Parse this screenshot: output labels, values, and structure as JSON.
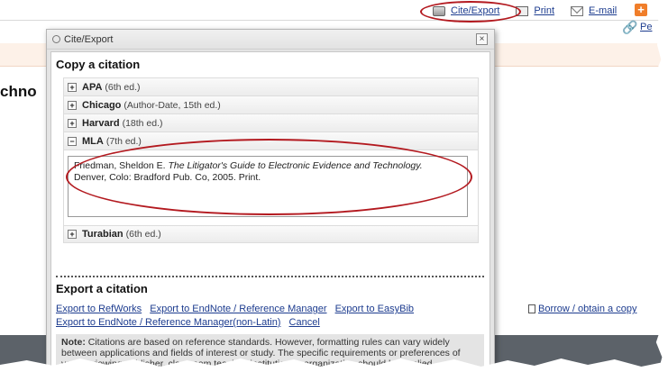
{
  "top_links": {
    "cite_export": "Cite/Export",
    "print": "Print",
    "email": "E-mail",
    "permalink": "Pe"
  },
  "background": {
    "title_fragment": "chno",
    "borrow": "Borrow / obtain a copy"
  },
  "dialog": {
    "title": "Cite/Export",
    "close": "×",
    "copy_heading": "Copy a citation",
    "styles": [
      {
        "name": "APA",
        "edition": "(6th ed.)",
        "toggle": "+"
      },
      {
        "name": "Chicago",
        "edition": "(Author-Date, 15th ed.)",
        "toggle": "+"
      },
      {
        "name": "Harvard",
        "edition": "(18th ed.)",
        "toggle": "+"
      },
      {
        "name": "MLA",
        "edition": "(7th ed.)",
        "toggle": "−"
      },
      {
        "name": "Turabian",
        "edition": "(6th ed.)",
        "toggle": "+"
      }
    ],
    "mla_citation": {
      "author": "Friedman, Sheldon E.",
      "title": "The Litigator's Guide to Electronic Evidence and Technology.",
      "rest": "Denver, Colo: Bradford Pub. Co, 2005. Print."
    },
    "export_heading": "Export a citation",
    "export_links": [
      "Export to RefWorks",
      "Export to EndNote / Reference Manager",
      "Export to EasyBib",
      "Export to EndNote / Reference Manager(non-Latin)",
      "Cancel"
    ],
    "note_label": "Note:",
    "note_text": "Citations are based on reference standards. However, formatting rules can vary widely between applications and fields of interest or study. The specific requirements or preferences of your reviewing publisher, classroom teacher, institution or organization should be applied."
  },
  "colors": {
    "annotation_red": "#b3191f",
    "link_blue": "#1d3c8f",
    "footer_gray": "#5c6269",
    "orange_accent": "#f07e2a"
  }
}
